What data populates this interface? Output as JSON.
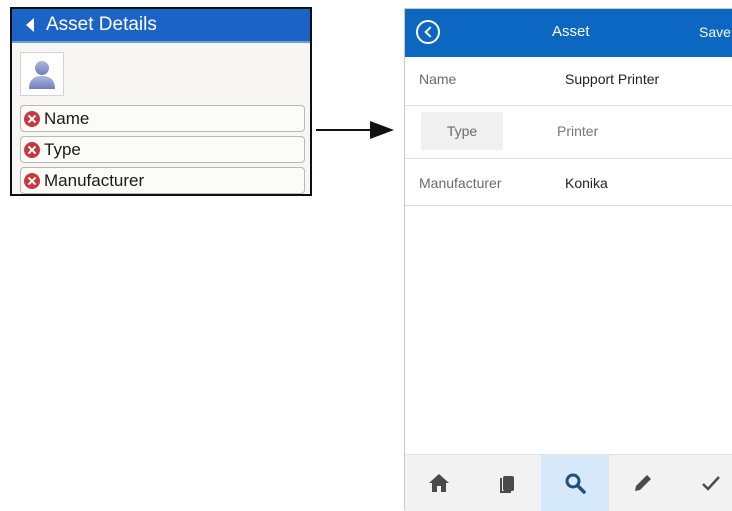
{
  "legacy": {
    "title": "Asset Details",
    "fields": [
      {
        "label": "Name"
      },
      {
        "label": "Type"
      },
      {
        "label": "Manufacturer"
      }
    ]
  },
  "mobile": {
    "header": {
      "title": "Asset",
      "save_label": "Save"
    },
    "fields": {
      "name": {
        "label": "Name",
        "value": "Support Printer"
      },
      "type": {
        "label": "Type",
        "value": "Printer"
      },
      "manufacturer": {
        "label": "Manufacturer",
        "value": "Konika"
      }
    },
    "toolbar": {
      "items": [
        "home-icon",
        "copy-icon",
        "search-icon",
        "edit-icon",
        "check-icon"
      ],
      "active": "search-icon"
    }
  },
  "colors": {
    "legacy_header": "#1c63c8",
    "mobile_header": "#0b67c2",
    "required_marker": "#c7393b",
    "toolbar_active": "#d6e9fb"
  }
}
